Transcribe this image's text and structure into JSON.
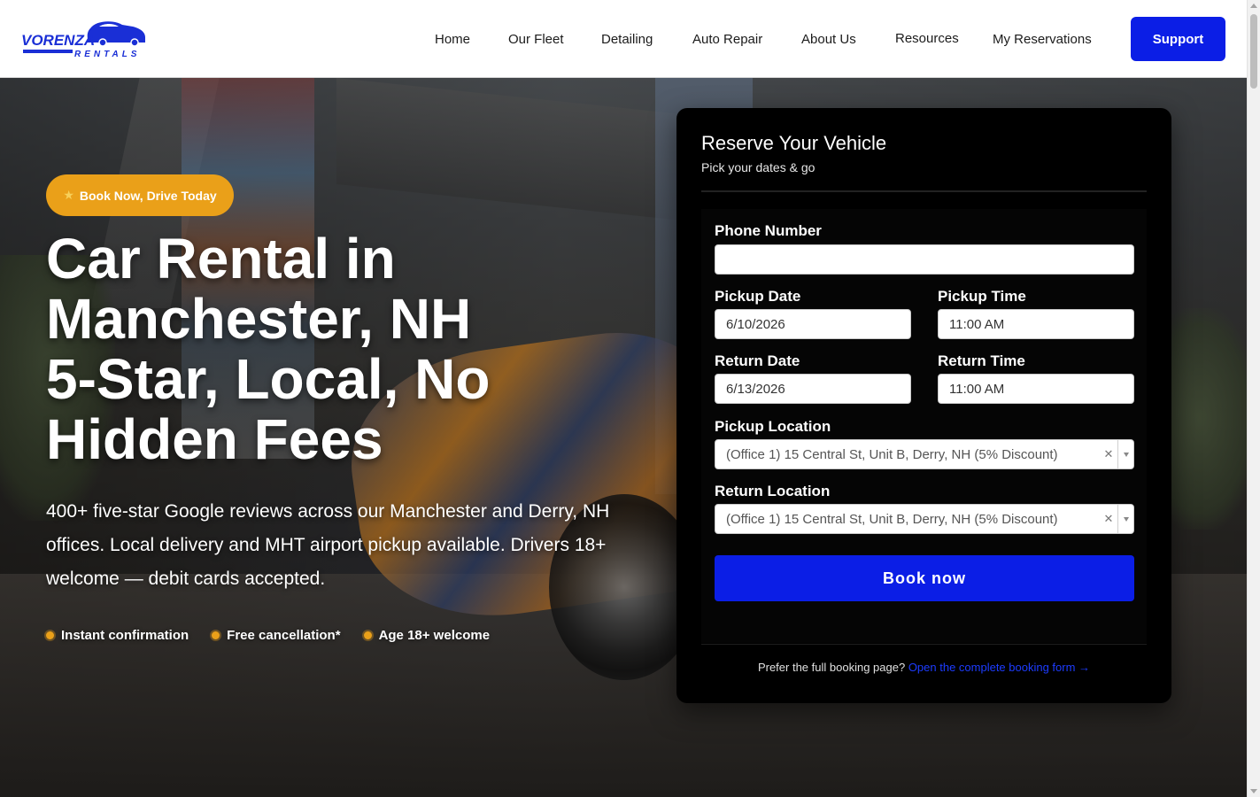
{
  "header": {
    "logo_top": "VORENZA",
    "logo_bottom": "RENTALS",
    "nav": [
      "Home",
      "Our Fleet",
      "Detailing",
      "Auto Repair",
      "About Us",
      "Resources",
      "My Reservations"
    ],
    "support_label": "Support"
  },
  "hero": {
    "badge": "Book Now, Drive Today",
    "title_lines": [
      "Car Rental in",
      "Manchester, NH",
      "5-Star, Local, No",
      "Hidden Fees"
    ],
    "description": "400+ five-star Google reviews across our Manchester and Derry, NH offices. Local delivery and MHT airport pickup available. Drivers 18+ welcome — debit cards accepted.",
    "features": [
      "Instant confirmation",
      "Free cancellation*",
      "Age 18+ welcome"
    ]
  },
  "booking": {
    "title": "Reserve Your Vehicle",
    "subtitle": "Pick your dates & go",
    "phone_label": "Phone Number",
    "phone_value": "",
    "pickup_date_label": "Pickup Date",
    "pickup_date_value": "6/10/2026",
    "pickup_time_label": "Pickup Time",
    "pickup_time_value": "11:00 AM",
    "return_date_label": "Return Date",
    "return_date_value": "6/13/2026",
    "return_time_label": "Return Time",
    "return_time_value": "11:00 AM",
    "pickup_location_label": "Pickup Location",
    "pickup_location_value": "(Office 1) 15 Central St, Unit B, Derry, NH (5% Discount)",
    "return_location_label": "Return Location",
    "return_location_value": "(Office 1) 15 Central St, Unit B, Derry, NH (5% Discount)",
    "book_label": "Book now",
    "footer_text": "Prefer the full booking page?",
    "footer_link": "Open the complete booking form →"
  },
  "colors": {
    "brand_blue": "#0b1ee6",
    "accent_orange": "#eaa019"
  }
}
